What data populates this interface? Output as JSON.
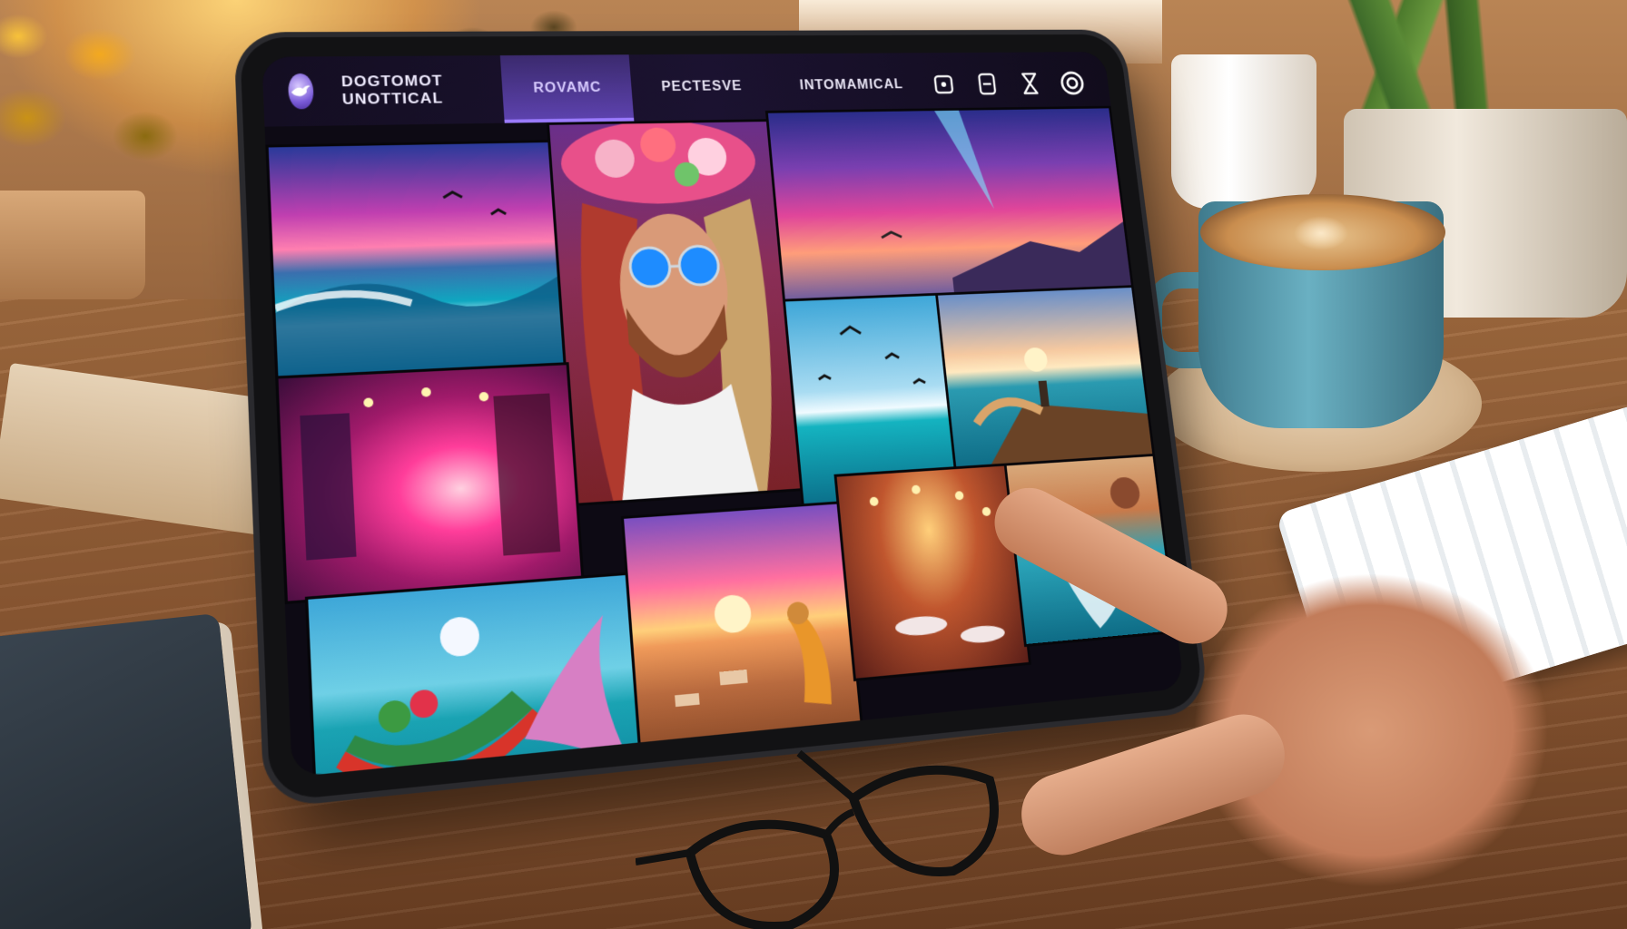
{
  "app": {
    "logo_icon": "bird-logo-icon",
    "title": "DOGTOMOT UNOTTICAL"
  },
  "tabs": [
    {
      "label": "ROVAMC",
      "active": true
    },
    {
      "label": "PECTESVE",
      "active": false
    },
    {
      "label": "INTOMAMICAL",
      "active": false
    }
  ],
  "toolbar": {
    "icons": [
      "square-dot-icon",
      "tablet-icon",
      "hourglass-icon",
      "target-icon"
    ]
  },
  "gallery": {
    "photos": [
      {
        "name": "photo-pink-sky-wave",
        "subject": "wave-under-pink-sky"
      },
      {
        "name": "photo-flower-crown-portrait",
        "subject": "man-in-flower-crown-blue-sunglasses"
      },
      {
        "name": "photo-aurora-sunset",
        "subject": "aurora-sunset-with-bird"
      },
      {
        "name": "photo-neon-hall",
        "subject": "neon-lit-hall"
      },
      {
        "name": "photo-birds-sea",
        "subject": "birds-over-sea"
      },
      {
        "name": "photo-pier-sunset",
        "subject": "pier-at-sunset"
      },
      {
        "name": "photo-moon-boat",
        "subject": "boat-and-bird-under-moon"
      },
      {
        "name": "photo-beach-sunset",
        "subject": "woman-on-beach-at-sunset"
      },
      {
        "name": "photo-lantern-restaurant",
        "subject": "lantern-lit-restaurant"
      },
      {
        "name": "photo-waterfall-coast",
        "subject": "coastal-waterfall"
      }
    ]
  },
  "colors": {
    "topbar": "#1b1230",
    "active_tab": "#5e43b0",
    "accent": "#9b7bff",
    "desk": "#8b5732"
  }
}
